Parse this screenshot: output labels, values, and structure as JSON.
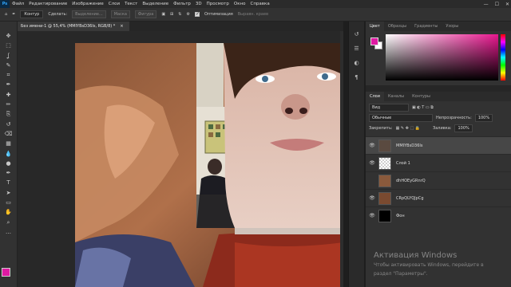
{
  "menubar": {
    "logo": "Ps",
    "items": [
      "Файл",
      "Редактирование",
      "Изображение",
      "Слои",
      "Текст",
      "Выделение",
      "Фильтр",
      "3D",
      "Просмотр",
      "Окно",
      "Справка"
    ],
    "window_controls": [
      "—",
      "☐",
      "✕"
    ]
  },
  "optbar": {
    "mode_select": "Контур",
    "labels": [
      "Сделать:",
      "Выделение...",
      "Маска",
      "Фигура"
    ],
    "auto_align": "Оптимизация",
    "align_edges": "Выравн. краев"
  },
  "document": {
    "tab_title": "Без имени-1 @ 55,4% (MMIYBsD36Is, RGB/8) *",
    "close": "×"
  },
  "toolbar": {
    "tools": [
      "move-icon",
      "marquee-icon",
      "lasso-icon",
      "quick-select-icon",
      "crop-icon",
      "eyedropper-icon",
      "healing-icon",
      "brush-icon",
      "stamp-icon",
      "history-brush-icon",
      "eraser-icon",
      "gradient-icon",
      "blur-icon",
      "dodge-icon",
      "pen-icon",
      "type-icon",
      "path-select-icon",
      "rectangle-icon",
      "hand-icon",
      "zoom-icon",
      "more-icon"
    ],
    "glyphs": [
      "✥",
      "⬚",
      "ʆ",
      "✎",
      "⌗",
      "✒",
      "✚",
      "✏",
      "⎘",
      "↺",
      "⌫",
      "▦",
      "💧",
      "●",
      "✒",
      "T",
      "➤",
      "▭",
      "✋",
      "⌕",
      "…"
    ]
  },
  "colors": {
    "foreground": "#e01aa3",
    "background": "#ffffff"
  },
  "panels": {
    "color_tabs": [
      "Цвет",
      "Образцы",
      "Градиенты",
      "Узоры"
    ],
    "layers_tabs": [
      "Слои",
      "Каналы",
      "Контуры"
    ],
    "kind_filter": "Вид",
    "blend_mode": "Обычные",
    "opacity_label": "Непрозрачность:",
    "opacity_value": "100%",
    "lock_label": "Закрепить:",
    "fill_label": "Заливка:",
    "fill_value": "100%",
    "layers": [
      {
        "name": "MMIYBsD36Is",
        "visible": true,
        "selected": true,
        "thumb": "#5a4a40"
      },
      {
        "name": "Слой 1",
        "visible": true,
        "selected": false,
        "thumb": "checker"
      },
      {
        "name": "dhHOEyGRnrQ",
        "visible": false,
        "selected": false,
        "thumb": "#8a5a3c"
      },
      {
        "name": "CRpQLYQJpCg",
        "visible": true,
        "selected": false,
        "thumb": "#7a4a30"
      },
      {
        "name": "Фон",
        "visible": true,
        "selected": false,
        "thumb": "#000000"
      }
    ]
  },
  "watermark": {
    "title": "Активация Windows",
    "line1": "Чтобы активировать Windows, перейдите в",
    "line2": "раздел \"Параметры\"."
  }
}
